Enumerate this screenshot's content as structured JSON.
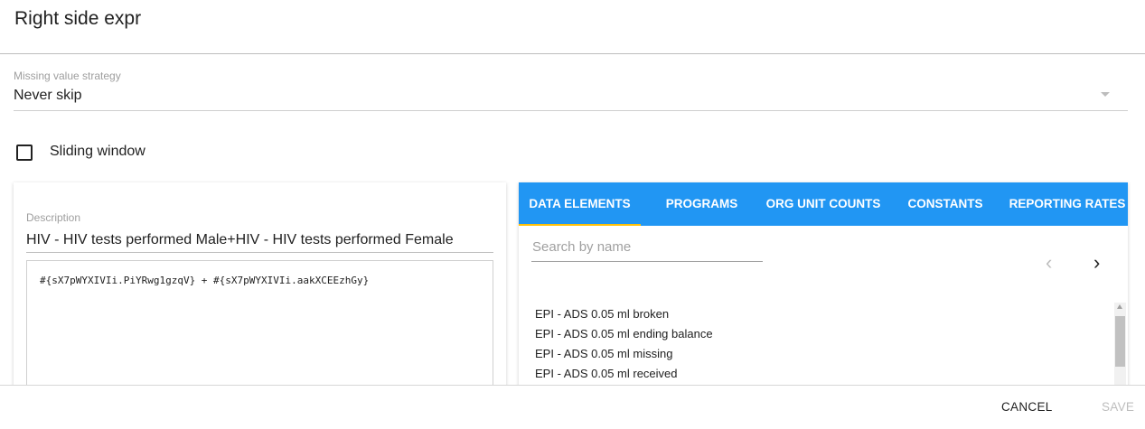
{
  "dialog": {
    "title": "Right side expr"
  },
  "missing_value_strategy": {
    "label": "Missing value strategy",
    "value": "Never skip"
  },
  "sliding_window": {
    "label": "Sliding window",
    "checked": false
  },
  "expression": {
    "description_label": "Description",
    "description_value": "HIV - HIV tests performed Male+HIV - HIV tests performed Female",
    "formula": "#{sX7pWYXIVIi.PiYRwg1gzqV} + #{sX7pWYXIVIi.aakXCEEzhGy}"
  },
  "tabs": [
    {
      "label": "DATA ELEMENTS",
      "active": true
    },
    {
      "label": "PROGRAMS",
      "active": false
    },
    {
      "label": "ORG UNIT COUNTS",
      "active": false
    },
    {
      "label": "CONSTANTS",
      "active": false
    },
    {
      "label": "REPORTING RATES",
      "active": false
    }
  ],
  "search": {
    "placeholder": "Search by name"
  },
  "pager": {
    "prev_icon": "chevron-left-icon",
    "next_icon": "chevron-right-icon"
  },
  "data_elements": [
    "EPI - ADS 0.05 ml broken",
    "EPI - ADS 0.05 ml ending balance",
    "EPI - ADS 0.05 ml missing",
    "EPI - ADS 0.05 ml received"
  ],
  "actions": {
    "cancel": "CANCEL",
    "save": "SAVE"
  },
  "colors": {
    "tab_bar": "#2196f3",
    "tab_indicator": "#ffc107",
    "disabled": "#bdbdbd"
  }
}
